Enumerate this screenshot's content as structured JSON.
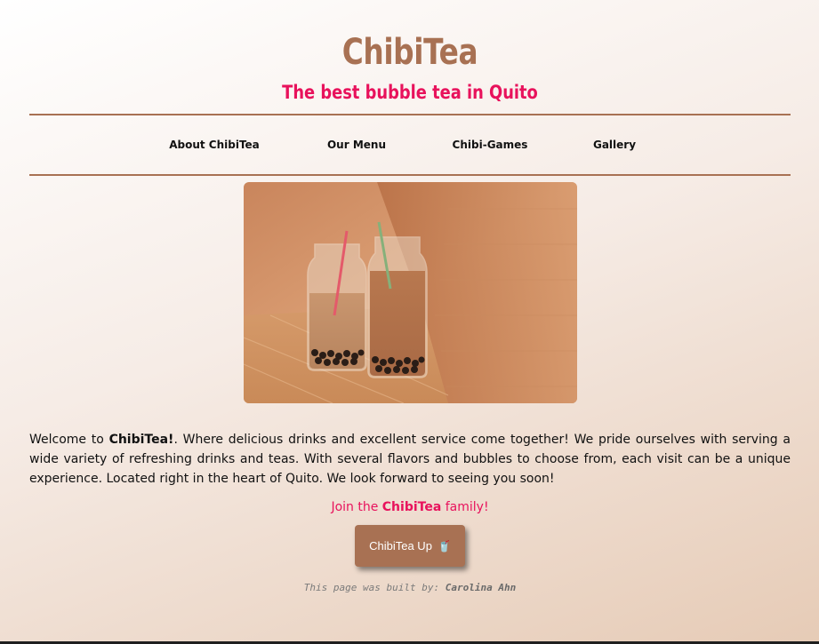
{
  "header": {
    "title": "ChibiTea",
    "tagline": "The best bubble tea in Quito"
  },
  "nav": {
    "items": [
      "About ChibiTea",
      "Our Menu",
      "Chibi-Games",
      "Gallery"
    ]
  },
  "intro": {
    "prefix": "Welcome to ",
    "brand": "ChibiTea!",
    "body": ". Where delicious drinks and excellent service come together! We pride ourselves with serving a wide variety of refreshing drinks and teas. With several flavors and bubbles to choose from, each visit can be a unique experience. Located right in the heart of Quito. We look forward to seeing you soon!"
  },
  "join": {
    "prefix": "Join the ",
    "brand": "ChibiTea",
    "suffix": " family!"
  },
  "cta": {
    "label": "ChibiTea Up",
    "icon": "cup-icon"
  },
  "footer": {
    "prefix": "This page was built by: ",
    "author": "Carolina Ahn"
  },
  "colors": {
    "brand": "#a87153",
    "accent": "#e8125c"
  }
}
